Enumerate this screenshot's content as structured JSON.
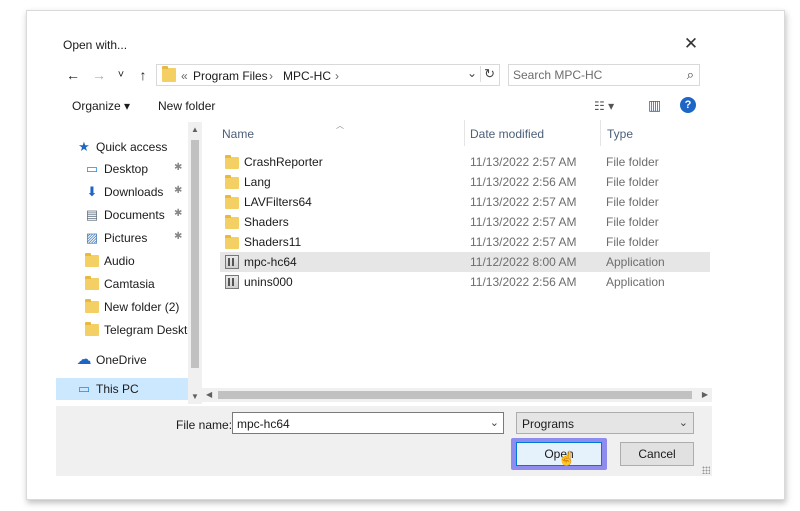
{
  "dialog": {
    "title": "Open with...",
    "close_glyph": "✕"
  },
  "nav": {
    "back_glyph": "←",
    "forward_glyph": "→",
    "recent_glyph": "˅",
    "up_glyph": "↑"
  },
  "address": {
    "prefix": "«",
    "crumbs": [
      "Program Files",
      "MPC-HC"
    ],
    "sep": "›",
    "dropdown_glyph": "⌄",
    "refresh_glyph": "↻"
  },
  "search": {
    "placeholder": "Search MPC-HC",
    "icon": "⌕"
  },
  "toolbar": {
    "organize_label": "Organize ▾",
    "new_folder_label": "New folder",
    "view_glyph": "☷ ▾",
    "pane_glyph": "▥",
    "help_glyph": "?"
  },
  "sidebar": {
    "items": [
      {
        "label": "Quick access",
        "icon": "star-icon",
        "glyph": "★",
        "pinned": false
      },
      {
        "label": "Desktop",
        "icon": "desktop-icon",
        "glyph": "▭",
        "pinned": true
      },
      {
        "label": "Downloads",
        "icon": "download-icon",
        "glyph": "⬇",
        "pinned": true
      },
      {
        "label": "Documents",
        "icon": "document-icon",
        "glyph": "▤",
        "pinned": true
      },
      {
        "label": "Pictures",
        "icon": "picture-icon",
        "glyph": "▨",
        "pinned": true
      },
      {
        "label": "Audio",
        "icon": "folder-icon",
        "pinned": false
      },
      {
        "label": "Camtasia",
        "icon": "folder-icon",
        "pinned": false
      },
      {
        "label": "New folder (2)",
        "icon": "folder-icon",
        "pinned": false
      },
      {
        "label": "Telegram Deskto",
        "icon": "folder-icon",
        "pinned": false
      },
      {
        "label": "OneDrive",
        "icon": "cloud-icon",
        "glyph": "☁",
        "pinned": false
      },
      {
        "label": "This PC",
        "icon": "computer-icon",
        "glyph": "▭",
        "pinned": false
      }
    ],
    "pin_glyph": "✱"
  },
  "files": {
    "columns": [
      "Name",
      "Date modified",
      "Type"
    ],
    "rows": [
      {
        "name": "CrashReporter",
        "date": "11/13/2022 2:57 AM",
        "type": "File folder",
        "icon": "folder-icon"
      },
      {
        "name": "Lang",
        "date": "11/13/2022 2:56 AM",
        "type": "File folder",
        "icon": "folder-icon"
      },
      {
        "name": "LAVFilters64",
        "date": "11/13/2022 2:57 AM",
        "type": "File folder",
        "icon": "folder-icon"
      },
      {
        "name": "Shaders",
        "date": "11/13/2022 2:57 AM",
        "type": "File folder",
        "icon": "folder-icon"
      },
      {
        "name": "Shaders11",
        "date": "11/13/2022 2:57 AM",
        "type": "File folder",
        "icon": "folder-icon"
      },
      {
        "name": "mpc-hc64",
        "date": "11/12/2022 8:00 AM",
        "type": "Application",
        "icon": "application-icon",
        "selected": true
      },
      {
        "name": "unins000",
        "date": "11/13/2022 2:56 AM",
        "type": "Application",
        "icon": "application-icon"
      }
    ]
  },
  "footer": {
    "file_name_label": "File name:",
    "file_name_value": "mpc-hc64",
    "file_type_value": "Programs",
    "open_label": "Open",
    "cancel_label": "Cancel",
    "dropdown_glyph": "⌄"
  },
  "colors": {
    "highlight": "#8f8cf0",
    "selected_row": "#e6e6e6",
    "selected_nav": "#cce8ff",
    "accent": "#0078d7"
  }
}
